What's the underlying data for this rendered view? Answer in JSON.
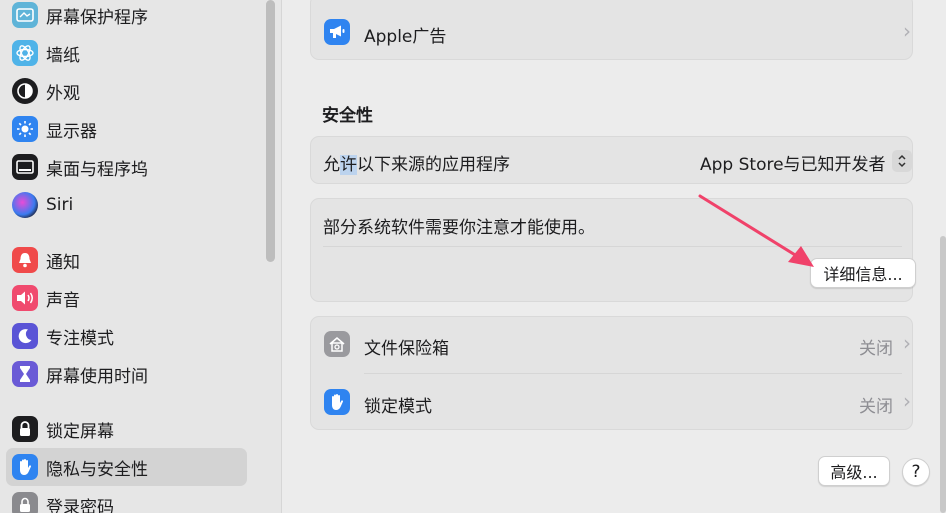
{
  "sidebar": {
    "items": [
      {
        "label": "屏幕保护程序",
        "icon": "screensaver-icon",
        "color": "#5fb4d8"
      },
      {
        "label": "墙纸",
        "icon": "wallpaper-icon",
        "color": "#4fb3e8"
      },
      {
        "label": "外观",
        "icon": "appearance-icon",
        "color": "#1d1d1f"
      },
      {
        "label": "显示器",
        "icon": "display-icon",
        "color": "#2f84f0"
      },
      {
        "label": "桌面与程序坞",
        "icon": "dock-icon",
        "color": "#1d1d1f"
      },
      {
        "label": "Siri",
        "icon": "siri-icon",
        "color": "#3a2a5a"
      },
      {
        "label": "通知",
        "icon": "bell-icon",
        "color": "#f04a4a"
      },
      {
        "label": "声音",
        "icon": "speaker-icon",
        "color": "#f04a6e"
      },
      {
        "label": "专注模式",
        "icon": "moon-icon",
        "color": "#5a54d6"
      },
      {
        "label": "屏幕使用时间",
        "icon": "hourglass-icon",
        "color": "#6a5ad6"
      },
      {
        "label": "锁定屏幕",
        "icon": "lock-icon",
        "color": "#1d1d1f"
      },
      {
        "label": "隐私与安全性",
        "icon": "hand-icon",
        "color": "#2f84f0"
      },
      {
        "label": "登录密码",
        "icon": "key-icon",
        "color": "#8a8a8e"
      }
    ]
  },
  "main": {
    "apple_ads": {
      "title": "Apple广告"
    },
    "security_title": "安全性",
    "allow_apps": {
      "prefix": "允",
      "highlighted": "许",
      "suffix": "以下来源的应用程序",
      "value": "App Store与已知开发者"
    },
    "system_software": {
      "text": "部分系统软件需要你注意才能使用。",
      "details_button": "详细信息..."
    },
    "filevault": {
      "title": "文件保险箱",
      "value": "关闭"
    },
    "lockdown": {
      "title": "锁定模式",
      "value": "关闭"
    },
    "advanced_button": "高级...",
    "help_button": "?"
  },
  "colors": {
    "accent": "#2f84f0",
    "arrow": "#f0426a"
  }
}
